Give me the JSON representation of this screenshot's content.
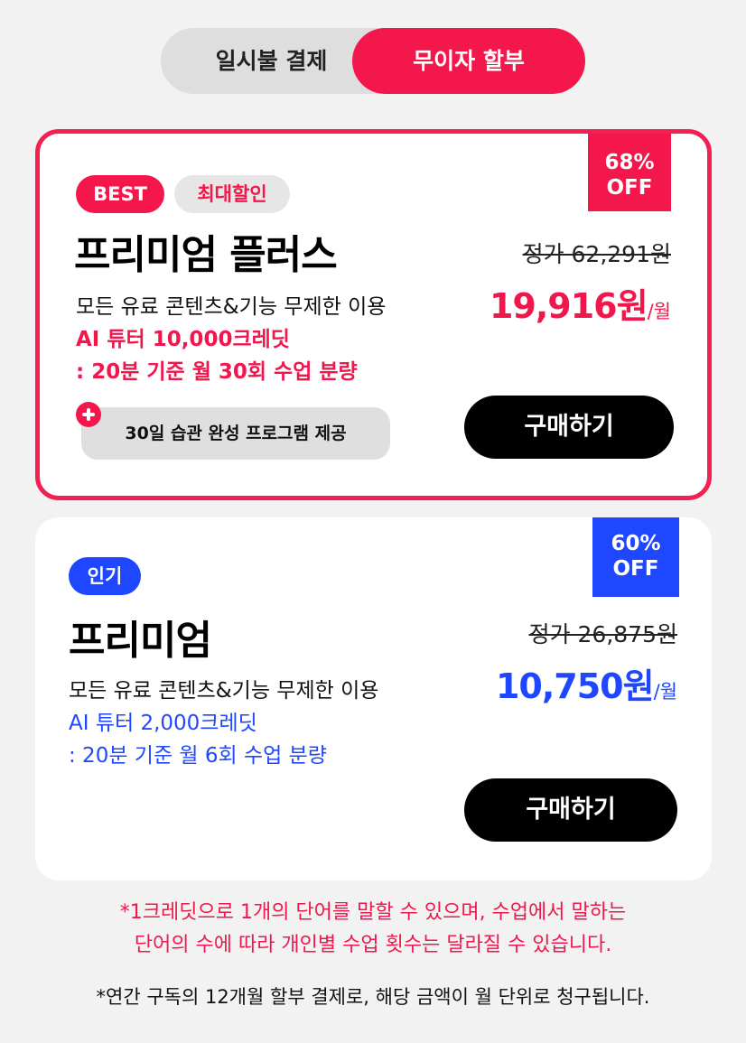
{
  "toggle": {
    "left_label": "일시불 결제",
    "right_label": "무이자 할부",
    "selected": "무이자 할부"
  },
  "plans": [
    {
      "badges": [
        "BEST",
        "최대할인"
      ],
      "discount": {
        "percent": "68%",
        "label": "OFF"
      },
      "title": "프리미엄 플러스",
      "desc_line1": "모든 유료 콘텐츠&기능 무제한 이용",
      "desc_line2": "AI 튜터 10,000크레딧",
      "desc_line3": ": 20분 기준 월 30회 수업 분량",
      "bonus": "30일 습관 완성 프로그램 제공",
      "original_price": "정가 62,291원",
      "price": "19,916원",
      "price_unit": "/월",
      "buy_label": "구매하기"
    },
    {
      "badges": [
        "인기"
      ],
      "discount": {
        "percent": "60%",
        "label": "OFF"
      },
      "title": "프리미엄",
      "desc_line1": "모든 유료 콘텐츠&기능 무제한 이용",
      "desc_line2": "AI 튜터 2,000크레딧",
      "desc_line3": ": 20분 기준 월 6회 수업 분량",
      "original_price": "정가 26,875원",
      "price": "10,750원",
      "price_unit": "/월",
      "buy_label": "구매하기"
    }
  ],
  "notes": {
    "credit_line1": "*1크레딧으로 1개의 단어를 말할 수 있으며, 수업에서 말하는",
    "credit_line2": "단어의 수에 따라 개인별 수업 횟수는 달라질 수 있습니다.",
    "billing": "*연간 구독의 12개월 할부 결제로, 해당 금액이 월 단위로 청구됩니다."
  },
  "colors": {
    "accent_red": "#f4174c",
    "accent_blue": "#1f47ff",
    "background": "#f2f2f2"
  },
  "icons": [
    "plus-icon"
  ]
}
